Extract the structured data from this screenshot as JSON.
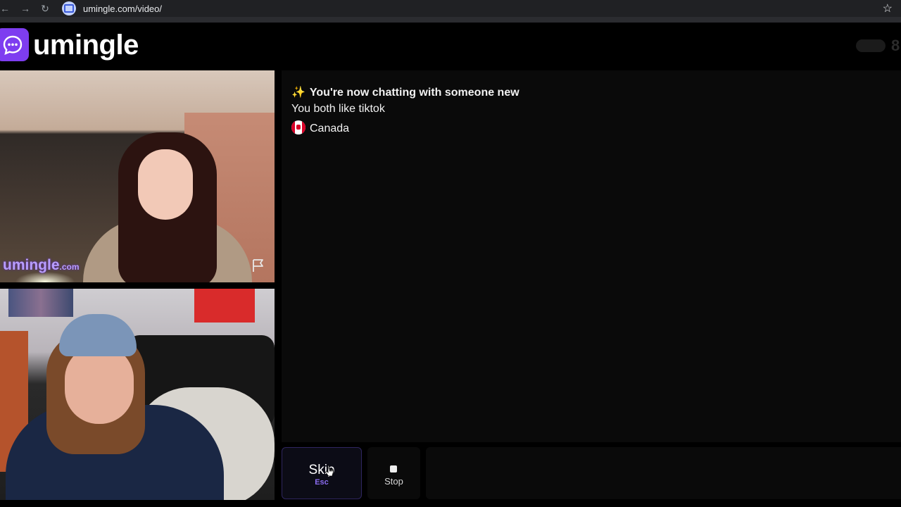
{
  "browser": {
    "url": "umingle.com/video/"
  },
  "header": {
    "logo_text": "umingle",
    "online_count": "8",
    "accent_color": "#7e3df0"
  },
  "stranger_video": {
    "watermark": "umingle",
    "watermark_suffix": ".com"
  },
  "chat": {
    "messages": [
      {
        "icon": "sparkles-icon",
        "text": "You're now chatting with someone new"
      },
      {
        "text": "You both like tiktok"
      },
      {
        "icon": "canada-flag-icon",
        "text": "Canada"
      }
    ]
  },
  "controls": {
    "skip_label": "Skip",
    "skip_shortcut": "Esc",
    "stop_label": "Stop"
  }
}
